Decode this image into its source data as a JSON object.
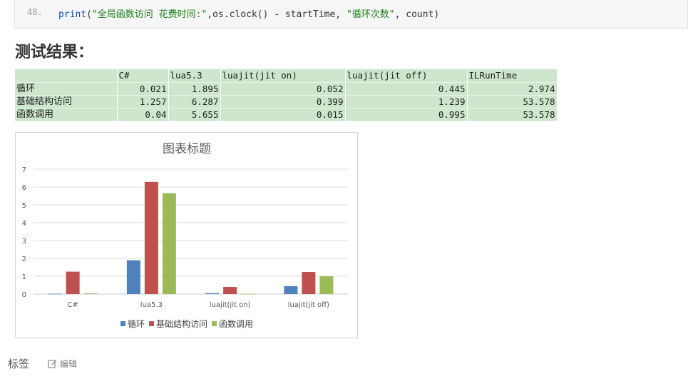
{
  "code": {
    "line_number": "48.",
    "fn": "print",
    "open": "(",
    "str1": "\"全局函数访问 花费时间:\"",
    "mid": ",os.clock() - startTime, ",
    "str2": "\"循环次数\"",
    "tail": ", count)"
  },
  "heading": "测试结果：",
  "table": {
    "headers": [
      "",
      "C#",
      "lua5.3",
      "luajit(jit on)",
      "luajit(jit off)",
      "ILRunTime"
    ],
    "rows": [
      {
        "label": "循环",
        "values": [
          "0.021",
          "1.895",
          "0.052",
          "0.445",
          "2.974"
        ]
      },
      {
        "label": "基础结构访问",
        "values": [
          "1.257",
          "6.287",
          "0.399",
          "1.239",
          "53.578"
        ]
      },
      {
        "label": "函数调用",
        "values": [
          "0.04",
          "5.655",
          "0.015",
          "0.995",
          "53.578"
        ]
      }
    ]
  },
  "chart_data": {
    "type": "bar",
    "title": "图表标题",
    "categories": [
      "C#",
      "lua5.3",
      "luajit(jit on)",
      "luajit(jit off)"
    ],
    "series": [
      {
        "name": "循环",
        "values": [
          0.021,
          1.895,
          0.052,
          0.445
        ],
        "color": "#4f81bd"
      },
      {
        "name": "基础结构访问",
        "values": [
          1.257,
          6.287,
          0.399,
          1.239
        ],
        "color": "#c0504d"
      },
      {
        "name": "函数调用",
        "values": [
          0.04,
          5.655,
          0.015,
          0.995
        ],
        "color": "#9bbb59"
      }
    ],
    "ylim": [
      0,
      7
    ],
    "yticks": [
      "0",
      "1",
      "2",
      "3",
      "4",
      "5",
      "6",
      "7"
    ],
    "grid": true,
    "legend": "bottom"
  },
  "footer": {
    "tags_label": "标签",
    "edit_label": "编辑"
  }
}
